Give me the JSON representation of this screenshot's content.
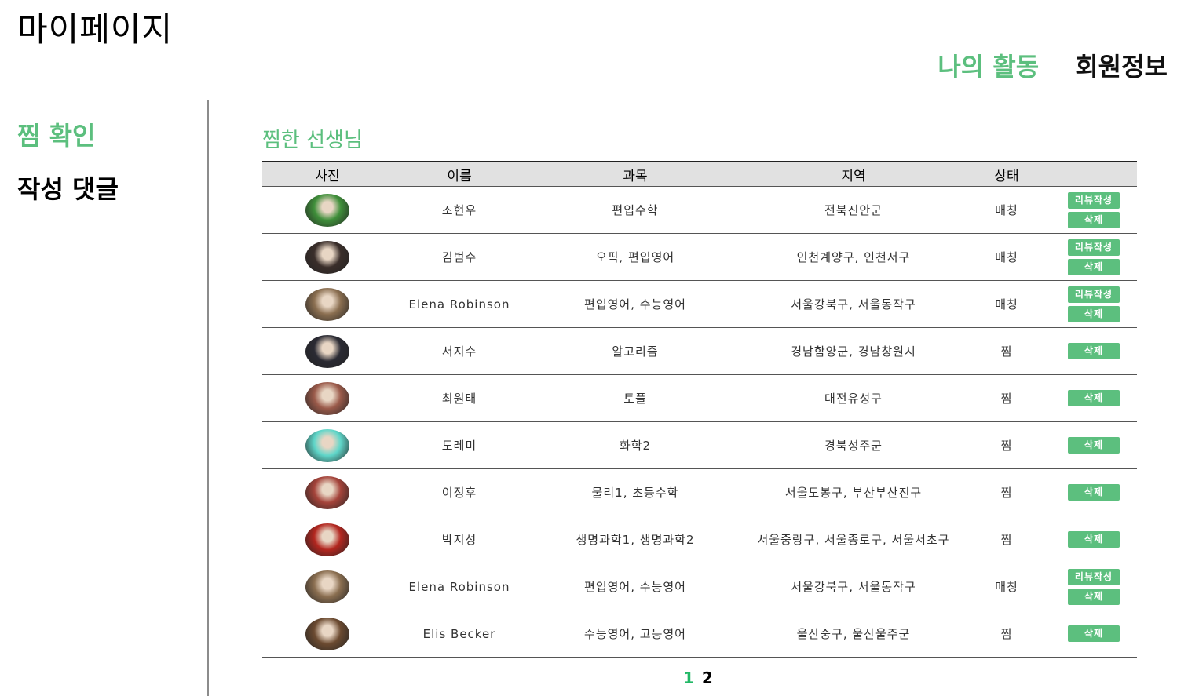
{
  "page_title": "마이페이지",
  "top_nav": {
    "activity": "나의 활동",
    "member_info": "회원정보"
  },
  "sidebar": {
    "items": [
      {
        "label": "찜 확인"
      },
      {
        "label": "작성 댓글"
      }
    ]
  },
  "section_title": "찜한 선생님",
  "table": {
    "headers": [
      "사진",
      "이름",
      "과목",
      "지역",
      "상태"
    ],
    "review_label": "리뷰작성",
    "delete_label": "삭제",
    "rows": [
      {
        "name": "조현우",
        "subject": "편입수학",
        "region": "전북진안군",
        "status": "매칭",
        "avatar_color": "#3f8f3a"
      },
      {
        "name": "김범수",
        "subject": "오픽, 편입영어",
        "region": "인천계양구, 인천서구",
        "status": "매칭",
        "avatar_color": "#3a2e2a"
      },
      {
        "name": "Elena Robinson",
        "subject": "편입영어, 수능영어",
        "region": "서울강북구, 서울동작구",
        "status": "매칭",
        "avatar_color": "#8a6e50"
      },
      {
        "name": "서지수",
        "subject": "알고리즘",
        "region": "경남함양군, 경남창원시",
        "status": "찜",
        "avatar_color": "#2a2a33"
      },
      {
        "name": "최원태",
        "subject": "토플",
        "region": "대전유성구",
        "status": "찜",
        "avatar_color": "#9a5a4a"
      },
      {
        "name": "도레미",
        "subject": "화학2",
        "region": "경북성주군",
        "status": "찜",
        "avatar_color": "#5fd6c9"
      },
      {
        "name": "이정후",
        "subject": "물리1, 초등수학",
        "region": "서울도봉구, 부산부산진구",
        "status": "찜",
        "avatar_color": "#a4433a"
      },
      {
        "name": "박지성",
        "subject": "생명과학1, 생명과학2",
        "region": "서울중랑구, 서울종로구, 서울서초구",
        "status": "찜",
        "avatar_color": "#b2261f"
      },
      {
        "name": "Elena Robinson",
        "subject": "편입영어, 수능영어",
        "region": "서울강북구, 서울동작구",
        "status": "매칭",
        "avatar_color": "#8a6e50"
      },
      {
        "name": "Elis Becker",
        "subject": "수능영어, 고등영어",
        "region": "울산중구, 울산울주군",
        "status": "찜",
        "avatar_color": "#6b4a30"
      }
    ]
  },
  "pagination": {
    "pages": [
      "1",
      "2"
    ],
    "current": "1"
  },
  "colors": {
    "accent": "#5cbf7e",
    "header_bg": "#e1e1e1"
  }
}
